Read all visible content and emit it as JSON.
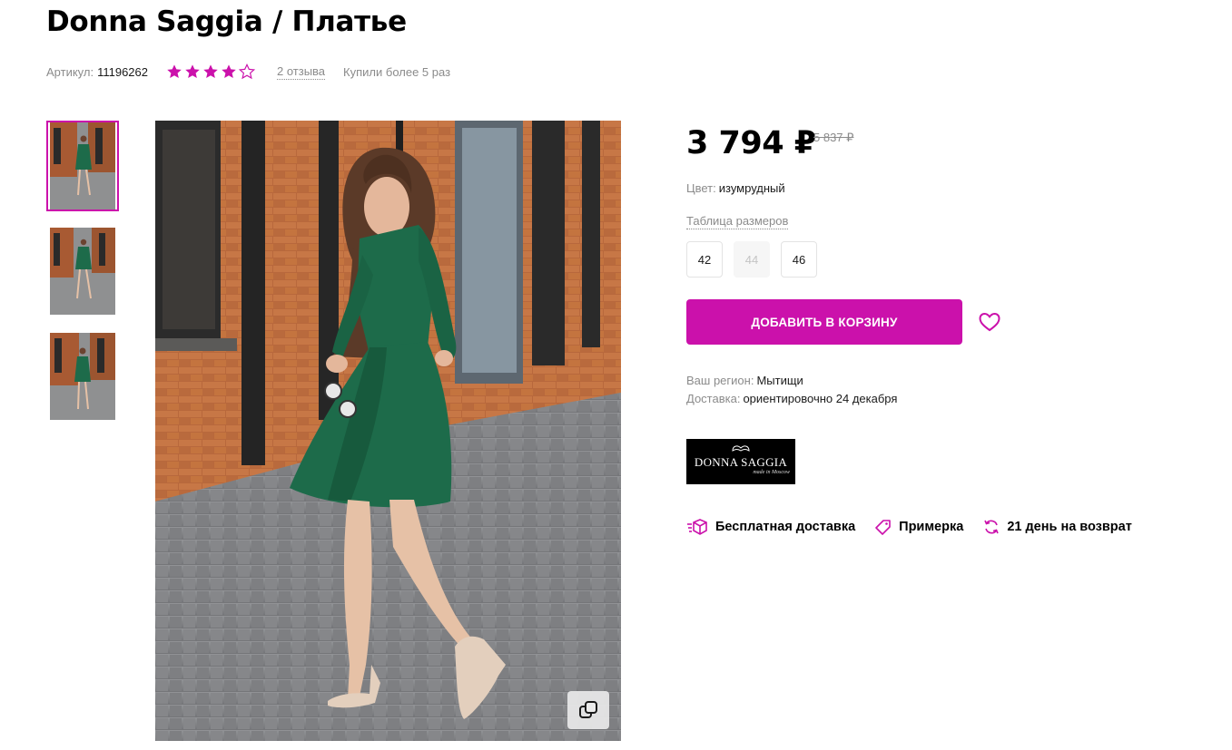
{
  "product": {
    "title": "Donna Saggia / Платье",
    "sku_label": "Артикул:",
    "sku_value": "11196262",
    "rating": 4,
    "rating_max": 5,
    "reviews": "2 отзыва",
    "bought": "Купили более 5 раз"
  },
  "price": {
    "current": "3 794 ₽",
    "old": "5 837 ₽"
  },
  "color": {
    "label": "Цвет:",
    "value": "изумрудный"
  },
  "size_table_link": "Таблица размеров",
  "sizes": [
    {
      "label": "42",
      "available": true
    },
    {
      "label": "44",
      "available": false
    },
    {
      "label": "46",
      "available": true
    }
  ],
  "add_to_cart": "ДОБАВИТЬ В КОРЗИНУ",
  "region": {
    "label": "Ваш регион:",
    "value": "Мытищи"
  },
  "delivery": {
    "label": "Доставка:",
    "value": "ориентировочно 24 декабря"
  },
  "brand": {
    "name": "DONNA SAGGIA",
    "tagline": "made in Moscow"
  },
  "benefits": {
    "free_delivery": "Бесплатная доставка",
    "fitting": "Примерка",
    "returns": "21 день на возврат"
  },
  "colors": {
    "accent": "#cb11ab",
    "muted_text": "#8b8b8b",
    "dress": "#1d6b4a"
  },
  "icons": {
    "star": "star-icon",
    "heart": "heart-icon",
    "zoom": "copy-zoom-icon",
    "delivery": "box-delivery-icon",
    "fitting": "tag-icon",
    "returns": "refresh-icon"
  }
}
